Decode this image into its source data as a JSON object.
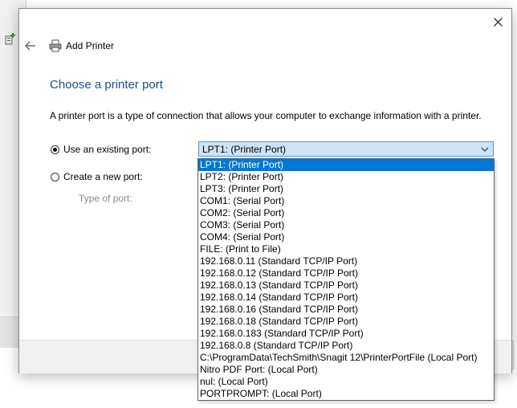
{
  "window": {
    "title": "Add Printer"
  },
  "page": {
    "heading": "Choose a printer port",
    "description": "A printer port is a type of connection that allows your computer to exchange information with a printer."
  },
  "options": {
    "existing_label": "Use an existing port:",
    "new_label": "Create a new port:",
    "type_label": "Type of port:",
    "selected_port": "LPT1: (Printer Port)"
  },
  "ports": [
    "LPT1: (Printer Port)",
    "LPT2: (Printer Port)",
    "LPT3: (Printer Port)",
    "COM1: (Serial Port)",
    "COM2: (Serial Port)",
    "COM3: (Serial Port)",
    "COM4: (Serial Port)",
    "FILE: (Print to File)",
    "192.168.0.11 (Standard TCP/IP Port)",
    "192.168.0.12 (Standard TCP/IP Port)",
    "192.168.0.13 (Standard TCP/IP Port)",
    "192.168.0.14 (Standard TCP/IP Port)",
    "192.168.0.16 (Standard TCP/IP Port)",
    "192.168.0.18 (Standard TCP/IP Port)",
    "192.168.0.183 (Standard TCP/IP Port)",
    "192.168.0.8 (Standard TCP/IP Port)",
    "C:\\ProgramData\\TechSmith\\Snagit 12\\PrinterPortFile (Local Port)",
    "Nitro PDF Port: (Local Port)",
    "nul: (Local Port)",
    "PORTPROMPT: (Local Port)"
  ],
  "colors": {
    "heading": "#1e4e8c",
    "selection": "#0078d7",
    "select_bg": "#cce4f7"
  },
  "icons": {
    "close": "close-icon",
    "back": "back-arrow-icon",
    "printer": "printer-icon",
    "dropdown": "chevron-down-icon"
  }
}
